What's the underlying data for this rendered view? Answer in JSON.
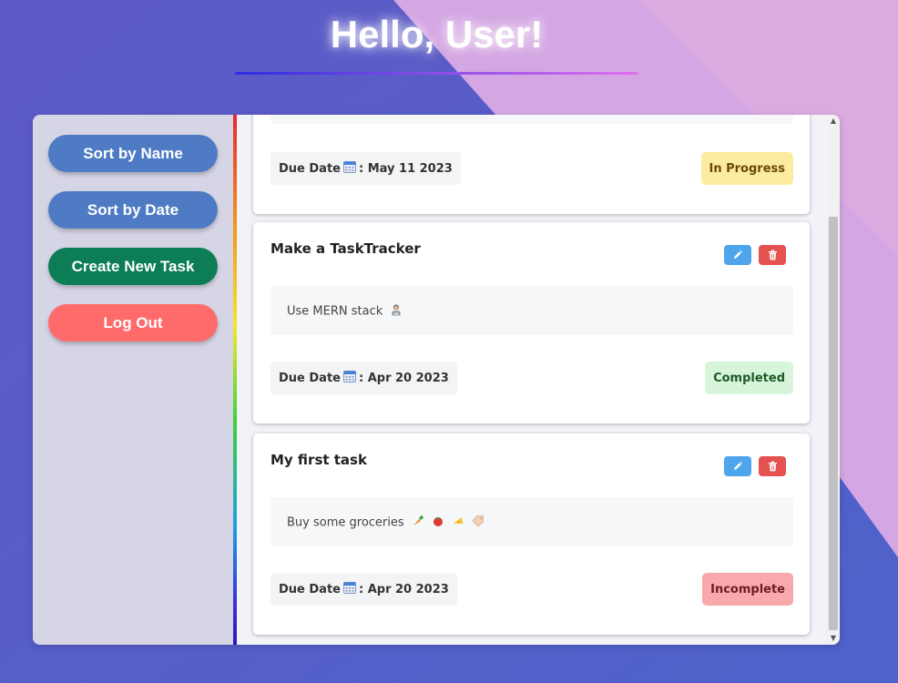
{
  "header": {
    "greeting": "Hello, User!"
  },
  "sidebar": {
    "sort_name": "Sort by Name",
    "sort_date": "Sort by Date",
    "create_task": "Create New Task",
    "log_out": "Log Out"
  },
  "tasks": [
    {
      "due_prefix": "Due Date",
      "due_date": ": May 11 2023",
      "status": "In Progress"
    },
    {
      "title": "Make a TaskTracker",
      "description": "Use MERN stack",
      "due_prefix": "Due Date",
      "due_date": ": Apr 20 2023",
      "status": "Completed"
    },
    {
      "title": "My first task",
      "description": "Buy some groceries",
      "due_prefix": "Due Date",
      "due_date": ": Apr 20 2023",
      "status": "Incomplete"
    }
  ],
  "icons": {
    "calendar": "calendar-icon",
    "edit": "pencil-icon",
    "delete": "trash-icon",
    "developer": "technologist-emoji",
    "groceries": [
      "carrot-emoji",
      "tomato-emoji",
      "cheese-emoji",
      "price-tag-emoji"
    ]
  },
  "colors": {
    "sort_button": "#4e7bc4",
    "create_button": "#0c7d54",
    "logout_button": "#ff6b6b",
    "status_in_progress_bg": "#fcec9f",
    "status_in_progress_text": "#6a4a00",
    "status_completed_bg": "#d6f5da",
    "status_completed_text": "#1d5a2a",
    "status_incomplete_bg": "#f9a9ab",
    "status_incomplete_text": "#6e1c20"
  }
}
